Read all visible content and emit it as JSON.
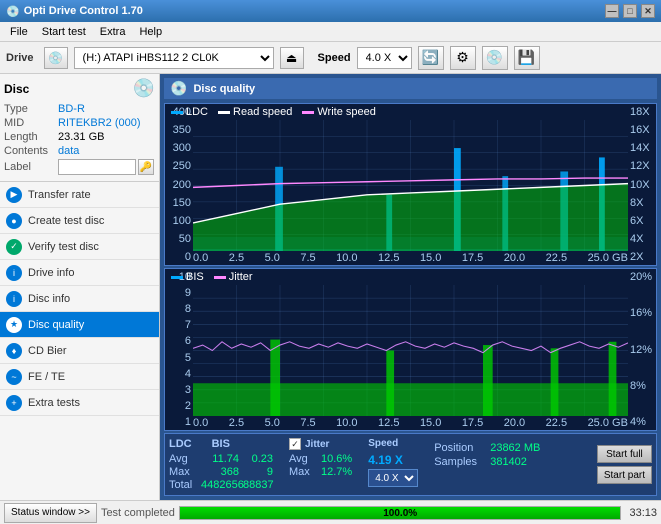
{
  "window": {
    "title": "Opti Drive Control 1.70",
    "min_btn": "—",
    "max_btn": "□",
    "close_btn": "✕"
  },
  "menu": {
    "items": [
      "File",
      "Start test",
      "Extra",
      "Help"
    ]
  },
  "drive_bar": {
    "drive_label": "Drive",
    "drive_value": "(H:) ATAPI iHBS112  2 CL0K",
    "speed_label": "Speed",
    "speed_value": "4.0 X",
    "eject_icon": "⏏"
  },
  "disc_panel": {
    "title": "Disc",
    "type_label": "Type",
    "type_value": "BD-R",
    "mid_label": "MID",
    "mid_value": "RITEKBR2 (000)",
    "length_label": "Length",
    "length_value": "23.31 GB",
    "contents_label": "Contents",
    "contents_value": "data",
    "label_label": "Label",
    "label_value": ""
  },
  "sidebar_items": [
    {
      "id": "transfer-rate",
      "label": "Transfer rate",
      "icon": "▶",
      "active": false
    },
    {
      "id": "create-test-disc",
      "label": "Create test disc",
      "icon": "●",
      "active": false
    },
    {
      "id": "verify-test-disc",
      "label": "Verify test disc",
      "icon": "✓",
      "active": false
    },
    {
      "id": "drive-info",
      "label": "Drive info",
      "icon": "i",
      "active": false
    },
    {
      "id": "disc-info",
      "label": "Disc info",
      "icon": "i",
      "active": false
    },
    {
      "id": "disc-quality",
      "label": "Disc quality",
      "icon": "★",
      "active": true
    },
    {
      "id": "cd-bier",
      "label": "CD Bier",
      "icon": "♦",
      "active": false
    },
    {
      "id": "fe-te",
      "label": "FE / TE",
      "icon": "~",
      "active": false
    },
    {
      "id": "extra-tests",
      "label": "Extra tests",
      "icon": "+",
      "active": false
    }
  ],
  "status_bar": {
    "btn_label": "Status window >>",
    "progress_pct": 100,
    "progress_text": "100.0%",
    "time": "33:13",
    "status_text": "Test completed"
  },
  "disc_quality": {
    "title": "Disc quality",
    "legend": {
      "ldc": "LDC",
      "read_speed": "Read speed",
      "write_speed": "Write speed",
      "bis": "BIS",
      "jitter": "Jitter"
    },
    "top_chart": {
      "y_left": [
        "400",
        "350",
        "300",
        "250",
        "200",
        "150",
        "100",
        "50",
        "0"
      ],
      "y_right": [
        "18X",
        "16X",
        "14X",
        "12X",
        "10X",
        "8X",
        "6X",
        "4X",
        "2X"
      ],
      "x_axis": [
        "0.0",
        "2.5",
        "5.0",
        "7.5",
        "10.0",
        "12.5",
        "15.0",
        "17.5",
        "20.0",
        "22.5",
        "25.0 GB"
      ]
    },
    "bottom_chart": {
      "y_left": [
        "10",
        "9",
        "8",
        "7",
        "6",
        "5",
        "4",
        "3",
        "2",
        "1"
      ],
      "y_right": [
        "20%",
        "16%",
        "12%",
        "8%",
        "4%"
      ],
      "x_axis": [
        "0.0",
        "2.5",
        "5.0",
        "7.5",
        "10.0",
        "12.5",
        "15.0",
        "17.5",
        "20.0",
        "22.5",
        "25.0 GB"
      ]
    },
    "stats": {
      "avg_ldc": "11.74",
      "avg_bis": "0.23",
      "avg_jitter": "10.6%",
      "max_ldc": "368",
      "max_bis": "9",
      "max_jitter": "12.7%",
      "total_ldc": "4482656",
      "total_bis": "88837",
      "speed_label": "Speed",
      "speed_value": "4.19 X",
      "speed_select": "4.0 X",
      "position_label": "Position",
      "position_value": "23862 MB",
      "samples_label": "Samples",
      "samples_value": "381402",
      "jitter_checked": true
    },
    "buttons": {
      "start_full": "Start full",
      "start_part": "Start part"
    }
  }
}
